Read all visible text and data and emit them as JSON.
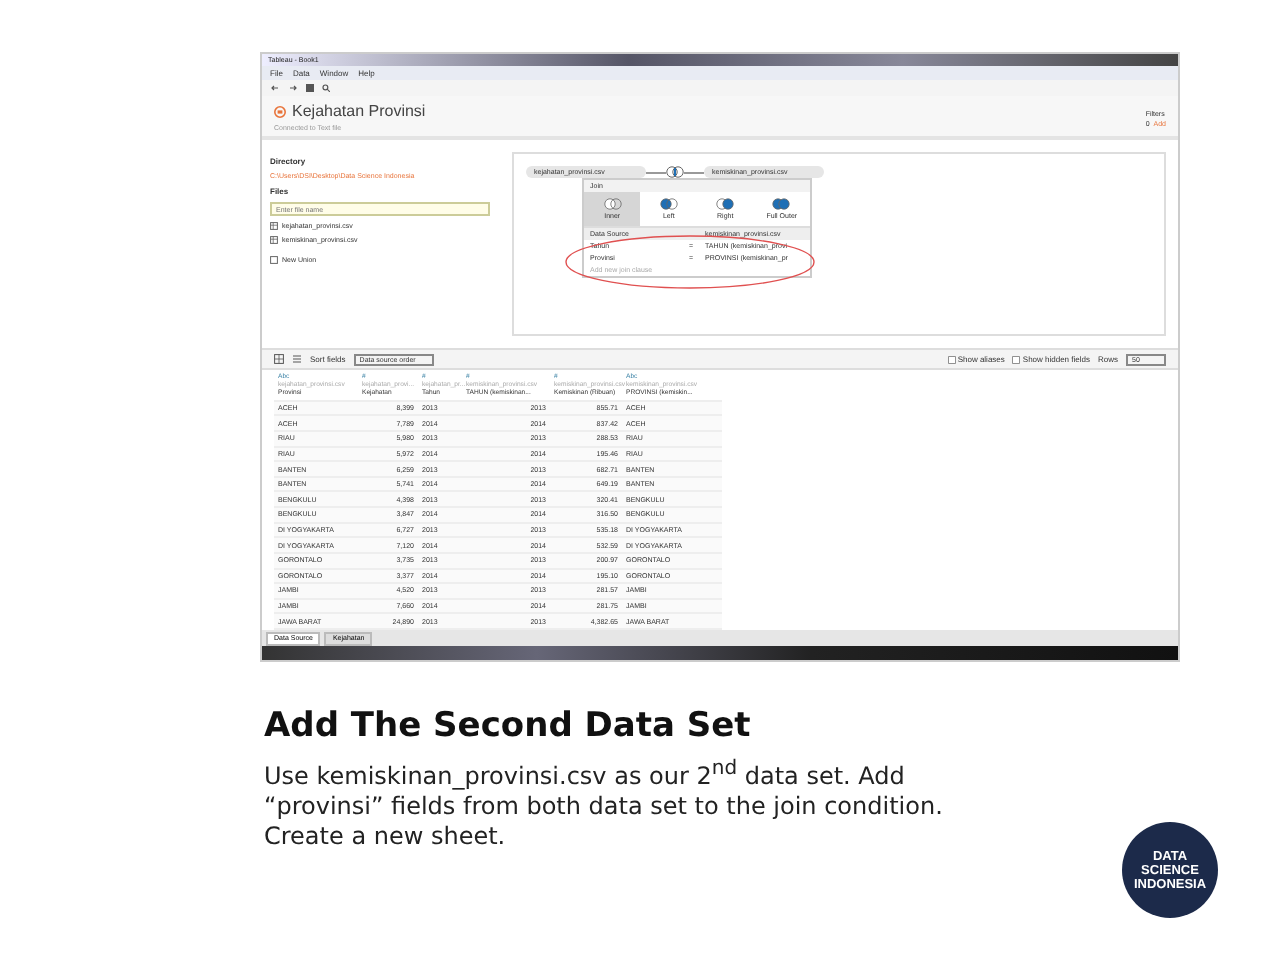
{
  "app": {
    "title": "Tableau - Book1",
    "menu": [
      "File",
      "Data",
      "Window",
      "Help"
    ],
    "data_source_title": "Kejahatan Provinsi",
    "connection": "Connected to Text file",
    "filters": {
      "label": "Filters",
      "count": "0",
      "action": "Add"
    },
    "sidebar": {
      "directory_heading": "Directory",
      "directory_path": "C:\\Users\\DSI\\Desktop\\Data Science Indonesia",
      "files_heading": "Files",
      "file_search": {
        "placeholder": "Enter file name"
      },
      "files": [
        "kejahatan_provinsi.csv",
        "kemiskinan_provinsi.csv"
      ],
      "new_union": "New Union"
    },
    "join": {
      "left_table": "kejahatan_provinsi.csv",
      "right_table": "kemiskinan_provinsi.csv",
      "dialog_title": "Join",
      "types": [
        {
          "label": "Inner",
          "selected": true
        },
        {
          "label": "Left",
          "selected": false
        },
        {
          "label": "Right",
          "selected": false
        },
        {
          "label": "Full Outer",
          "selected": false
        }
      ],
      "left_header": "Data Source",
      "right_header": "kemiskinan_provinsi.csv",
      "conditions": [
        {
          "left": "Tahun",
          "op": "=",
          "right": "TAHUN (kemiskinan_provi"
        },
        {
          "left": "Provinsi",
          "op": "=",
          "right": "PROVINSI (kemiskinan_pr"
        }
      ],
      "add_condition": "Add new join clause"
    },
    "grid_toolbar": {
      "sort_label": "Sort fields",
      "sort_value": "Data source order",
      "options": [
        {
          "label": "Show aliases",
          "checked": false
        },
        {
          "label": "Show hidden fields",
          "checked": false
        }
      ],
      "rows_label": "Rows",
      "rows_value": "50"
    },
    "table": {
      "columns": [
        {
          "type": "Abc",
          "source": "kejahatan_provinsi.csv",
          "name": "Provinsi",
          "kind": "text"
        },
        {
          "type": "#",
          "source": "kejahatan_provi...",
          "name": "Kejahatan",
          "kind": "number"
        },
        {
          "type": "#",
          "source": "kejahatan_pr...",
          "name": "Tahun",
          "kind": "text"
        },
        {
          "type": "#",
          "source": "kemiskinan_provinsi.csv",
          "name": "TAHUN (kemiskinan...",
          "kind": "number"
        },
        {
          "type": "#",
          "source": "kemiskinan_provinsi.csv",
          "name": "Kemiskinan (Ribuan)",
          "kind": "number"
        },
        {
          "type": "Abc",
          "source": "kemiskinan_provinsi.csv",
          "name": "PROVINSI (kemiskin...",
          "kind": "text"
        }
      ],
      "rows": [
        [
          "ACEH",
          "8,399",
          "2013",
          "2013",
          "855.71",
          "ACEH"
        ],
        [
          "ACEH",
          "7,789",
          "2014",
          "2014",
          "837.42",
          "ACEH"
        ],
        [
          "RIAU",
          "5,980",
          "2013",
          "2013",
          "288.53",
          "RIAU"
        ],
        [
          "RIAU",
          "5,972",
          "2014",
          "2014",
          "195.46",
          "RIAU"
        ],
        [
          "BANTEN",
          "6,259",
          "2013",
          "2013",
          "682.71",
          "BANTEN"
        ],
        [
          "BANTEN",
          "5,741",
          "2014",
          "2014",
          "649.19",
          "BANTEN"
        ],
        [
          "BENGKULU",
          "4,398",
          "2013",
          "2013",
          "320.41",
          "BENGKULU"
        ],
        [
          "BENGKULU",
          "3,847",
          "2014",
          "2014",
          "316.50",
          "BENGKULU"
        ],
        [
          "DI YOGYAKARTA",
          "6,727",
          "2013",
          "2013",
          "535.18",
          "DI YOGYAKARTA"
        ],
        [
          "DI YOGYAKARTA",
          "7,120",
          "2014",
          "2014",
          "532.59",
          "DI YOGYAKARTA"
        ],
        [
          "GORONTALO",
          "3,735",
          "2013",
          "2013",
          "200.97",
          "GORONTALO"
        ],
        [
          "GORONTALO",
          "3,377",
          "2014",
          "2014",
          "195.10",
          "GORONTALO"
        ],
        [
          "JAMBI",
          "4,520",
          "2013",
          "2013",
          "281.57",
          "JAMBI"
        ],
        [
          "JAMBI",
          "7,660",
          "2014",
          "2014",
          "281.75",
          "JAMBI"
        ],
        [
          "JAWA BARAT",
          "24,890",
          "2013",
          "2013",
          "4,382.65",
          "JAWA BARAT"
        ]
      ]
    },
    "sheet_tabs": [
      {
        "label": "Data Source",
        "selected": true
      },
      {
        "label": "Kejahatan",
        "selected": false
      }
    ]
  },
  "slide": {
    "heading": "Add The Second Data Set",
    "body": "Use kemiskinan_provinsi.csv as our 2$^{nd}$ data set. Add “provinsi” fields from both data set to the join condition. Create a new sheet.",
    "logo": [
      "DATA",
      "SCIENCE",
      "INDONESIA"
    ]
  }
}
